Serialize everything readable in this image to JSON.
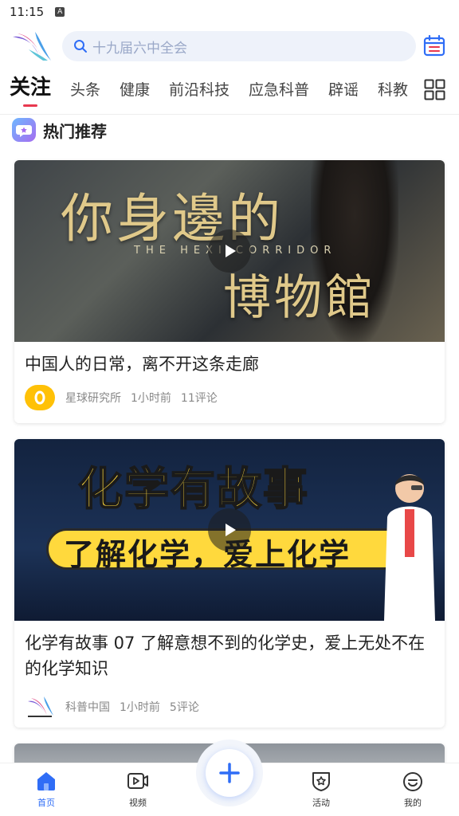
{
  "status_bar": {
    "time": "11:15",
    "indicator": "A"
  },
  "header": {
    "logo_icon": "kepu-china-logo",
    "search_placeholder": "十九届六中全会",
    "calendar_icon": "calendar-icon"
  },
  "tabs": [
    {
      "label": "关注",
      "active": true
    },
    {
      "label": "头条"
    },
    {
      "label": "健康"
    },
    {
      "label": "前沿科技"
    },
    {
      "label": "应急科普"
    },
    {
      "label": "辟谣"
    },
    {
      "label": "科教"
    }
  ],
  "section": {
    "title": "热门推荐"
  },
  "cards": [
    {
      "thumbnail_text": "你身邊的",
      "thumbnail_subtext": "THE HEXI CORRIDOR",
      "thumbnail_text2": "博物館",
      "title": "中国人的日常，离不开这条走廊",
      "source": "星球研究所",
      "time": "1小时前",
      "comments": "11评论"
    },
    {
      "thumbnail_text": "化学有故事",
      "thumbnail_subtext": "了解化学，爱上化学",
      "title": "化学有故事 07 了解意想不到的化学史，爱上无处不在的化学知识",
      "source": "科普中国",
      "time": "1小时前",
      "comments": "5评论"
    }
  ],
  "bottom_nav": [
    {
      "label": "首页",
      "icon": "home-icon",
      "active": true
    },
    {
      "label": "视频",
      "icon": "video-icon"
    },
    {
      "label": "活动",
      "icon": "activity-icon"
    },
    {
      "label": "我的",
      "icon": "profile-icon"
    }
  ],
  "colors": {
    "accent": "#2f6df6",
    "tab_indicator": "#e8384f",
    "search_bg": "#eef2fa"
  }
}
